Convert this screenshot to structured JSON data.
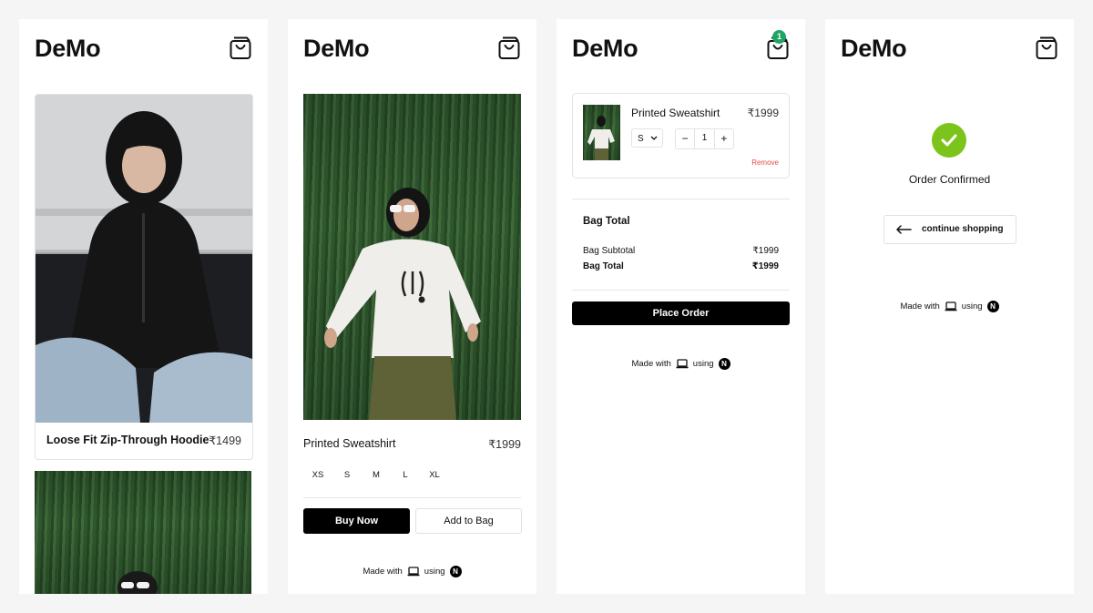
{
  "brand": "DeMo",
  "cart_count": "1",
  "currency_symbol": "₹",
  "listing": {
    "product_name": "Loose Fit Zip-Through Hoodie",
    "product_price": "₹1499"
  },
  "detail": {
    "product_name": "Printed Sweatshirt",
    "product_price": "₹1999",
    "sizes": [
      "XS",
      "S",
      "M",
      "L",
      "XL"
    ],
    "buy_now_label": "Buy Now",
    "add_to_bag_label": "Add to Bag"
  },
  "bag": {
    "item_name": "Printed Sweatshirt",
    "item_price": "₹1999",
    "selected_size": "S",
    "quantity": "1",
    "remove_label": "Remove",
    "total_heading": "Bag Total",
    "subtotal_label": "Bag Subtotal",
    "subtotal_value": "₹1999",
    "total_label": "Bag Total",
    "total_value": "₹1999",
    "place_order_label": "Place Order"
  },
  "confirmation": {
    "message": "Order Confirmed",
    "continue_label": "continue shopping"
  },
  "footer": {
    "made_with": "Made with",
    "using": "using",
    "framework_initial": "N"
  },
  "colors": {
    "badge": "#21a366",
    "success": "#7cc41c",
    "danger": "#e64a4a",
    "primary_button": "#000000"
  },
  "icons": [
    "bag-icon",
    "chevron-down-icon",
    "minus-icon",
    "plus-icon",
    "check-icon",
    "arrow-left-icon",
    "laptop-icon",
    "nextjs-logo-icon"
  ]
}
